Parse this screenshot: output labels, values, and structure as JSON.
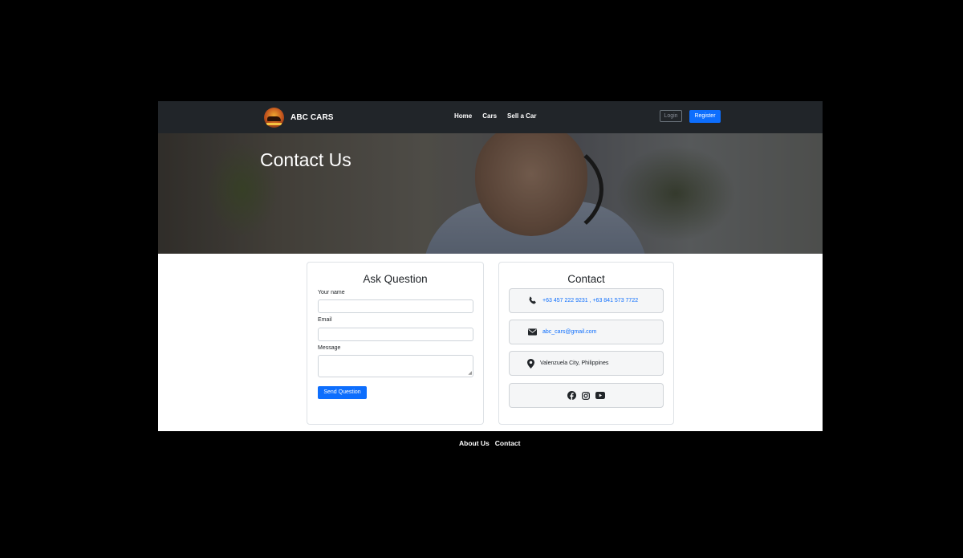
{
  "navbar": {
    "brand": "ABC CARS",
    "links": [
      "Home",
      "Cars",
      "Sell a Car"
    ],
    "login_label": "Login",
    "register_label": "Register"
  },
  "hero": {
    "title": "Contact Us"
  },
  "ask_form": {
    "title": "Ask Question",
    "name_label": "Your name",
    "email_label": "Email",
    "message_label": "Message",
    "name_value": "",
    "email_value": "",
    "message_value": "",
    "send_label": "Send Question"
  },
  "contact": {
    "title": "Contact",
    "phones": "+63 457 222 9231 , +63 841 573 7722",
    "email": "abc_cars@gmail.com",
    "location": "Valenzuela City, Philippines",
    "social_icons": [
      "facebook-icon",
      "instagram-icon",
      "youtube-icon"
    ]
  },
  "footer": {
    "links": [
      "About Us",
      "Contact"
    ]
  },
  "colors": {
    "navbar": "#212529",
    "primary": "#0d6efd",
    "page_bg": "#000000"
  }
}
